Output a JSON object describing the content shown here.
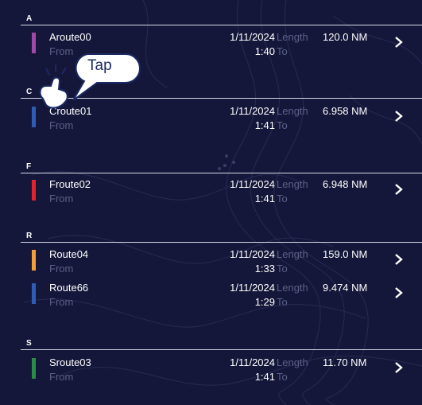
{
  "colors": {
    "background": "#15173a",
    "muted_label": "#5b6086",
    "swatch_purple": "#a04aa7",
    "swatch_blue": "#2f5cb4",
    "swatch_red": "#e2232b",
    "swatch_orange": "#f29f3a",
    "swatch_green": "#2d8a47"
  },
  "callout": {
    "text": "Tap",
    "icon": "tapping-hand-icon"
  },
  "groups": [
    {
      "letter": "A",
      "routes": [
        {
          "name": "Aroute00",
          "date": "1/11/2024",
          "time": "1:40",
          "length_label": "Length",
          "length": "120.0 NM",
          "from_label": "From",
          "to_label": "To",
          "color": "#a04aa7"
        }
      ]
    },
    {
      "letter": "C",
      "routes": [
        {
          "name": "Croute01",
          "date": "1/11/2024",
          "time": "1:41",
          "length_label": "Length",
          "length": "6.958 NM",
          "from_label": "From",
          "to_label": "To",
          "color": "#2f5cb4"
        }
      ]
    },
    {
      "letter": "F",
      "routes": [
        {
          "name": "Froute02",
          "date": "1/11/2024",
          "time": "1:41",
          "length_label": "Length",
          "length": "6.948 NM",
          "from_label": "From",
          "to_label": "To",
          "color": "#e2232b"
        }
      ]
    },
    {
      "letter": "R",
      "routes": [
        {
          "name": "Route04",
          "date": "1/11/2024",
          "time": "1:33",
          "length_label": "Length",
          "length": "159.0 NM",
          "from_label": "From",
          "to_label": "To",
          "color": "#f29f3a"
        },
        {
          "name": "Route66",
          "date": "1/11/2024",
          "time": "1:29",
          "length_label": "Length",
          "length": "9.474 NM",
          "from_label": "From",
          "to_label": "To",
          "color": "#2f5cb4"
        }
      ]
    },
    {
      "letter": "S",
      "routes": [
        {
          "name": "Sroute03",
          "date": "1/11/2024",
          "time": "1:41",
          "length_label": "Length",
          "length": "11.70 NM",
          "from_label": "From",
          "to_label": "To",
          "color": "#2d8a47"
        }
      ]
    }
  ]
}
